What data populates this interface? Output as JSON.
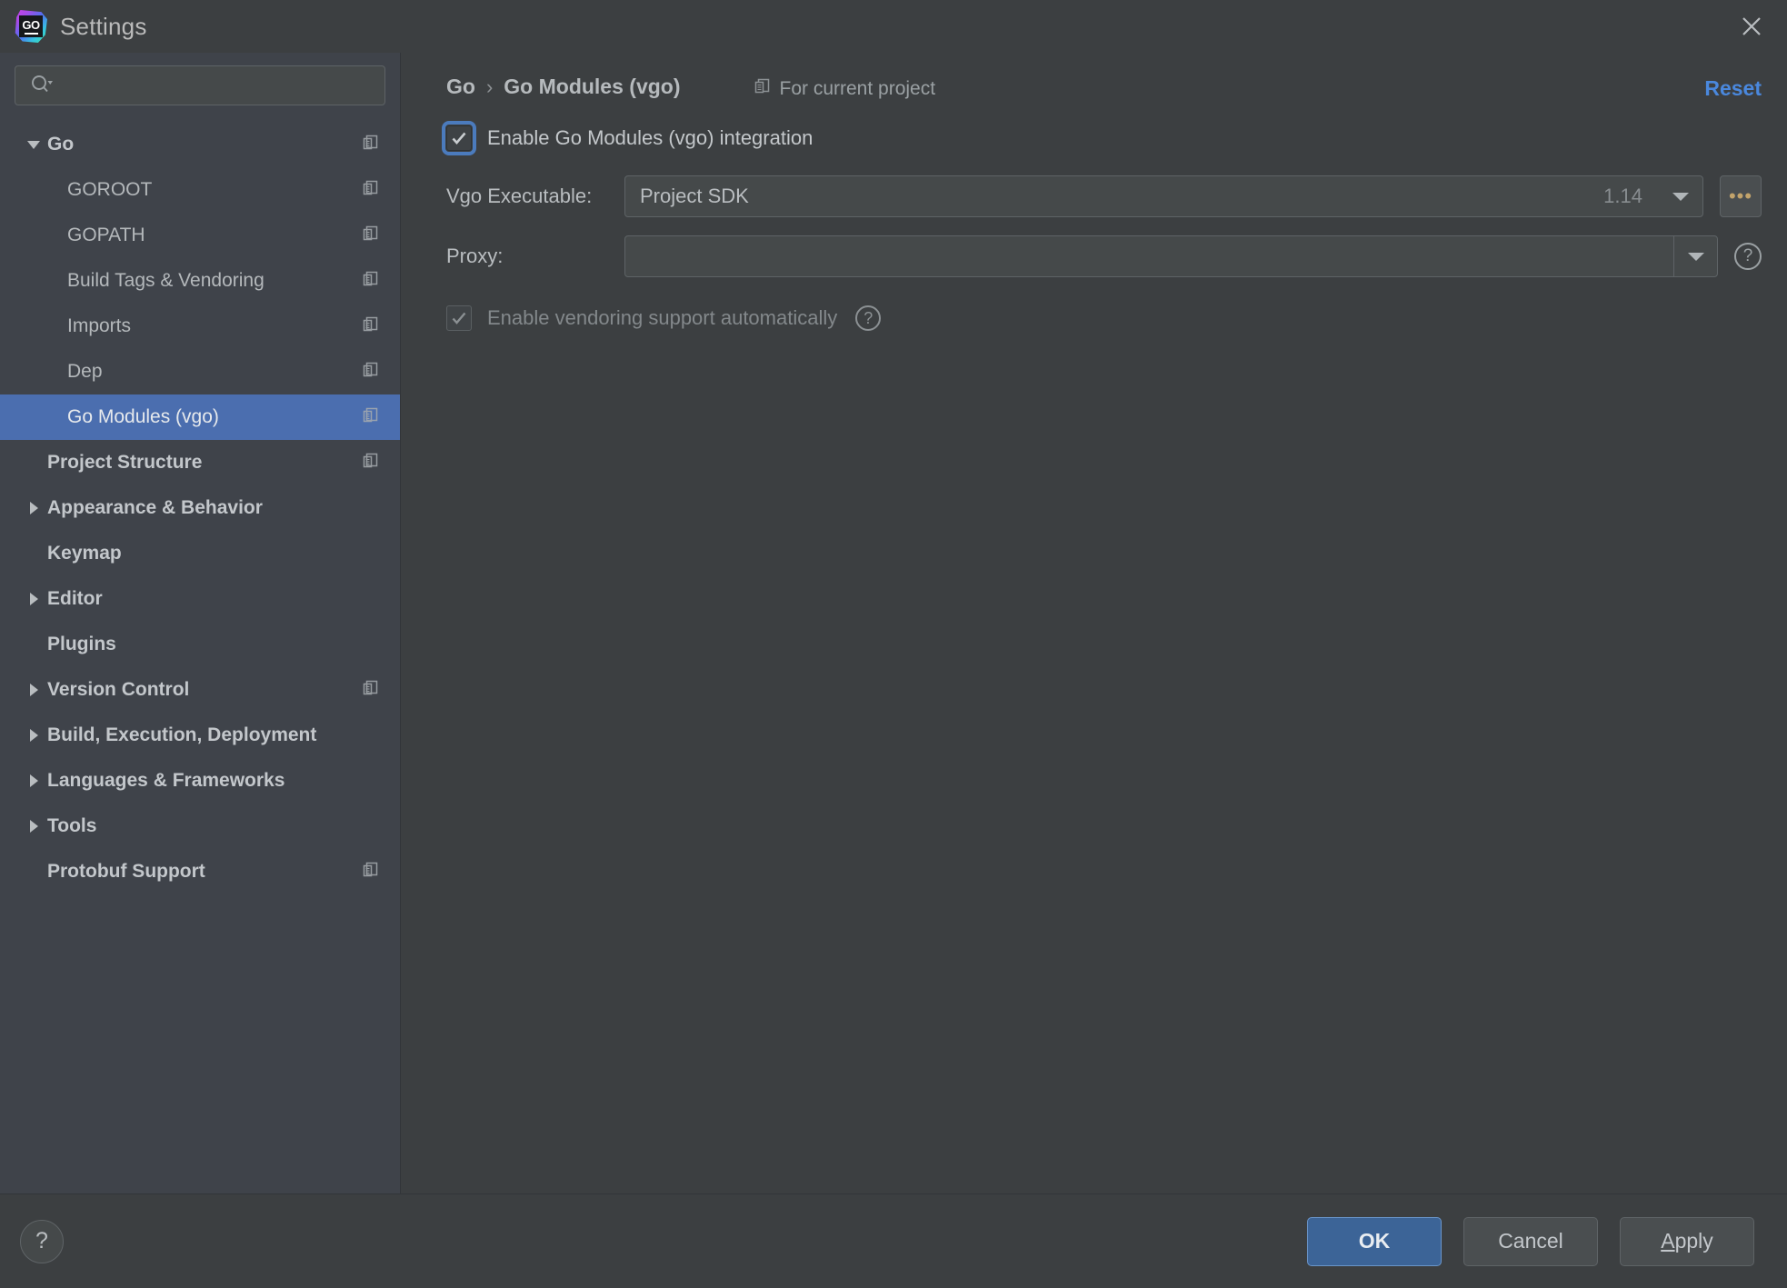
{
  "window": {
    "title": "Settings",
    "logo_text": "GO",
    "close_icon": "close-icon"
  },
  "sidebar": {
    "search": {
      "value": "",
      "placeholder": ""
    },
    "items": [
      {
        "label": "Go",
        "level": 0,
        "bold": true,
        "expanded": true,
        "twisty": "down",
        "project_icon": true,
        "selected": false
      },
      {
        "label": "GOROOT",
        "level": 1,
        "bold": false,
        "twisty": "none",
        "project_icon": true,
        "selected": false
      },
      {
        "label": "GOPATH",
        "level": 1,
        "bold": false,
        "twisty": "none",
        "project_icon": true,
        "selected": false
      },
      {
        "label": "Build Tags & Vendoring",
        "level": 1,
        "bold": false,
        "twisty": "none",
        "project_icon": true,
        "selected": false
      },
      {
        "label": "Imports",
        "level": 1,
        "bold": false,
        "twisty": "none",
        "project_icon": true,
        "selected": false
      },
      {
        "label": "Dep",
        "level": 1,
        "bold": false,
        "twisty": "none",
        "project_icon": true,
        "selected": false
      },
      {
        "label": "Go Modules (vgo)",
        "level": 1,
        "bold": false,
        "twisty": "none",
        "project_icon": true,
        "selected": true
      },
      {
        "label": "Project Structure",
        "level": 0,
        "bold": true,
        "twisty": "none",
        "project_icon": true,
        "selected": false
      },
      {
        "label": "Appearance & Behavior",
        "level": 0,
        "bold": true,
        "twisty": "right",
        "project_icon": false,
        "selected": false
      },
      {
        "label": "Keymap",
        "level": 0,
        "bold": true,
        "twisty": "none",
        "project_icon": false,
        "selected": false
      },
      {
        "label": "Editor",
        "level": 0,
        "bold": true,
        "twisty": "right",
        "project_icon": false,
        "selected": false
      },
      {
        "label": "Plugins",
        "level": 0,
        "bold": true,
        "twisty": "none",
        "project_icon": false,
        "selected": false
      },
      {
        "label": "Version Control",
        "level": 0,
        "bold": true,
        "twisty": "right",
        "project_icon": true,
        "selected": false
      },
      {
        "label": "Build, Execution, Deployment",
        "level": 0,
        "bold": true,
        "twisty": "right",
        "project_icon": false,
        "selected": false
      },
      {
        "label": "Languages & Frameworks",
        "level": 0,
        "bold": true,
        "twisty": "right",
        "project_icon": false,
        "selected": false
      },
      {
        "label": "Tools",
        "level": 0,
        "bold": true,
        "twisty": "right",
        "project_icon": false,
        "selected": false
      },
      {
        "label": "Protobuf Support",
        "level": 0,
        "bold": true,
        "twisty": "none",
        "project_icon": true,
        "selected": false
      }
    ]
  },
  "main": {
    "breadcrumb": {
      "root": "Go",
      "separator": "›",
      "current": "Go Modules (vgo)"
    },
    "scope_label": "For current project",
    "reset_label": "Reset",
    "enable_integration": {
      "label": "Enable Go Modules (vgo) integration",
      "checked": true,
      "focused": true
    },
    "vgo_executable": {
      "label": "Vgo Executable:",
      "value": "Project SDK",
      "version": "1.14",
      "browse_label": "•••"
    },
    "proxy": {
      "label": "Proxy:",
      "value": "",
      "help_icon": "help-icon"
    },
    "vendoring": {
      "label": "Enable vendoring support automatically",
      "checked": true,
      "disabled": true,
      "help_icon": "help-icon"
    }
  },
  "footer": {
    "help_label": "?",
    "ok_label": "OK",
    "cancel_label": "Cancel",
    "apply_label": "Apply",
    "apply_mnemonic": "A",
    "apply_rest": "pply"
  }
}
